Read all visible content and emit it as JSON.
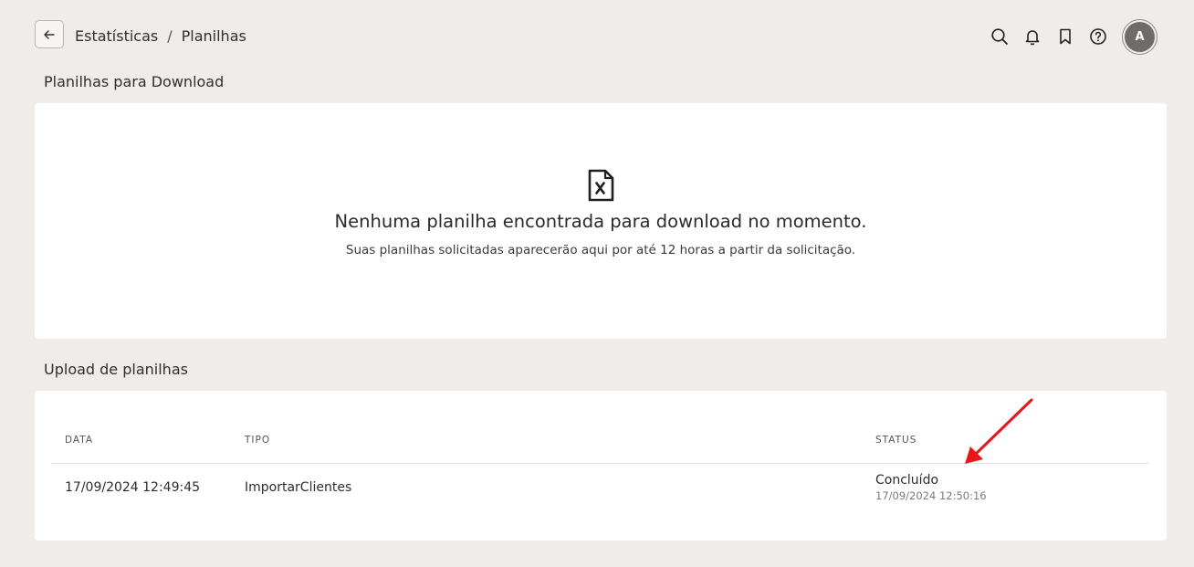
{
  "header": {
    "breadcrumb": [
      "Estatísticas",
      "Planilhas"
    ],
    "breadcrumb_separator": "/",
    "icons": [
      "search-icon",
      "bell-icon",
      "bookmark-icon",
      "help-icon"
    ],
    "avatar_initial": "A"
  },
  "download_section": {
    "title": "Planilhas para Download",
    "empty_icon": "file-x-icon",
    "empty_title": "Nenhuma planilha encontrada para download no momento.",
    "empty_subtitle": "Suas planilhas solicitadas aparecerão aqui por até 12 horas a partir da solicitação."
  },
  "upload_section": {
    "title": "Upload de planilhas",
    "columns": [
      "DATA",
      "TIPO",
      "STATUS"
    ],
    "rows": [
      {
        "data": "17/09/2024 12:49:45",
        "tipo": "ImportarClientes",
        "status": "Concluído",
        "status_date": "17/09/2024 12:50:16"
      }
    ]
  },
  "colors": {
    "background": "#efecea",
    "card": "#ffffff",
    "annotation_arrow": "#e8161b"
  }
}
